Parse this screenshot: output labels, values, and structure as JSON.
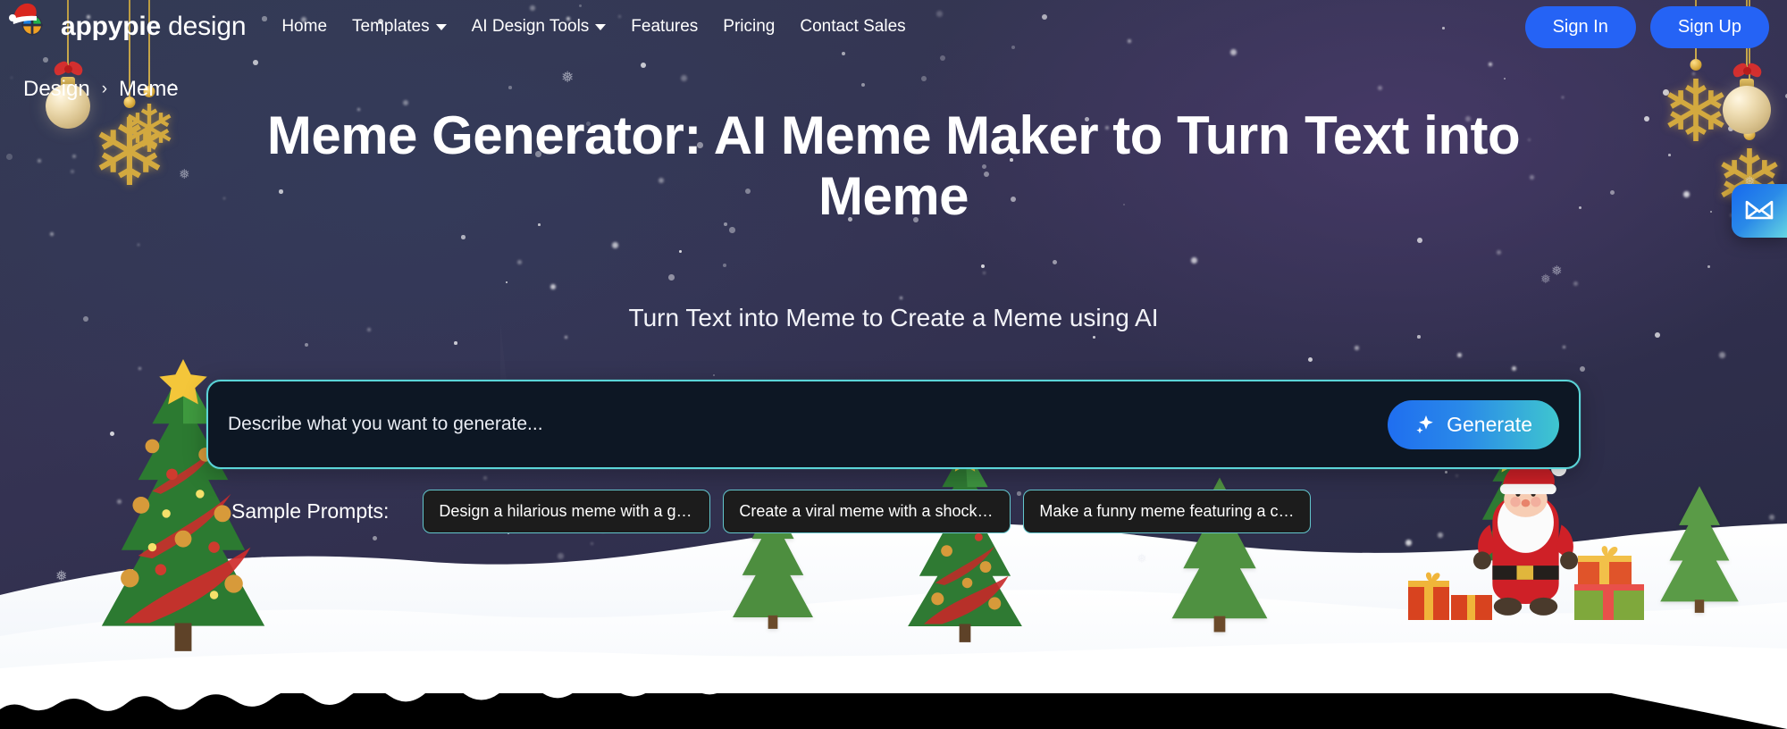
{
  "header": {
    "logo": {
      "icon": "appypie-logo-icon",
      "brand_bold": "appypie",
      "brand_light": "design",
      "santa_hat": "santa-hat-icon"
    },
    "nav": [
      {
        "label": "Home",
        "has_dropdown": false
      },
      {
        "label": "Templates",
        "has_dropdown": true
      },
      {
        "label": "AI Design Tools",
        "has_dropdown": true
      },
      {
        "label": "Features",
        "has_dropdown": false
      },
      {
        "label": "Pricing",
        "has_dropdown": false
      },
      {
        "label": "Contact Sales",
        "has_dropdown": false
      }
    ],
    "sign_in_label": "Sign In",
    "sign_up_label": "Sign Up",
    "auth_color": "#2563f5"
  },
  "breadcrumb": {
    "root": "Design",
    "separator": "›",
    "current": "Meme"
  },
  "hero": {
    "title": "Meme Generator: AI Meme Maker to Turn Text into Meme",
    "subtitle": "Turn Text into Meme to Create a Meme using AI"
  },
  "prompt": {
    "placeholder": "Describe what you want to generate...",
    "value": "",
    "generate_label": "Generate",
    "generate_icon": "sparkle-icon",
    "border_color": "#5bd5d8"
  },
  "samples": {
    "label": "Sample Prompts:",
    "items": [
      "Design a hilarious meme with a grumpy cat ...",
      "Create a viral meme with a shocked dog rea...",
      "Make a funny meme featuring a confused b..."
    ]
  },
  "floating": {
    "mail_tab_icon": "envelope-icon"
  },
  "decor": {
    "hanging": [
      "gold-snowflake-ornament",
      "gold-snowflake-ornament",
      "gold-snowflake-ornament",
      "gold-snowflake-ornament",
      "gold-bauble-ornament",
      "gold-bauble-ornament"
    ],
    "scene": [
      "christmas-tree-large",
      "christmas-tree-small",
      "christmas-tree-medium",
      "christmas-tree-small",
      "santa-claus",
      "gift-boxes",
      "snow-ground",
      "falling-snow"
    ]
  }
}
